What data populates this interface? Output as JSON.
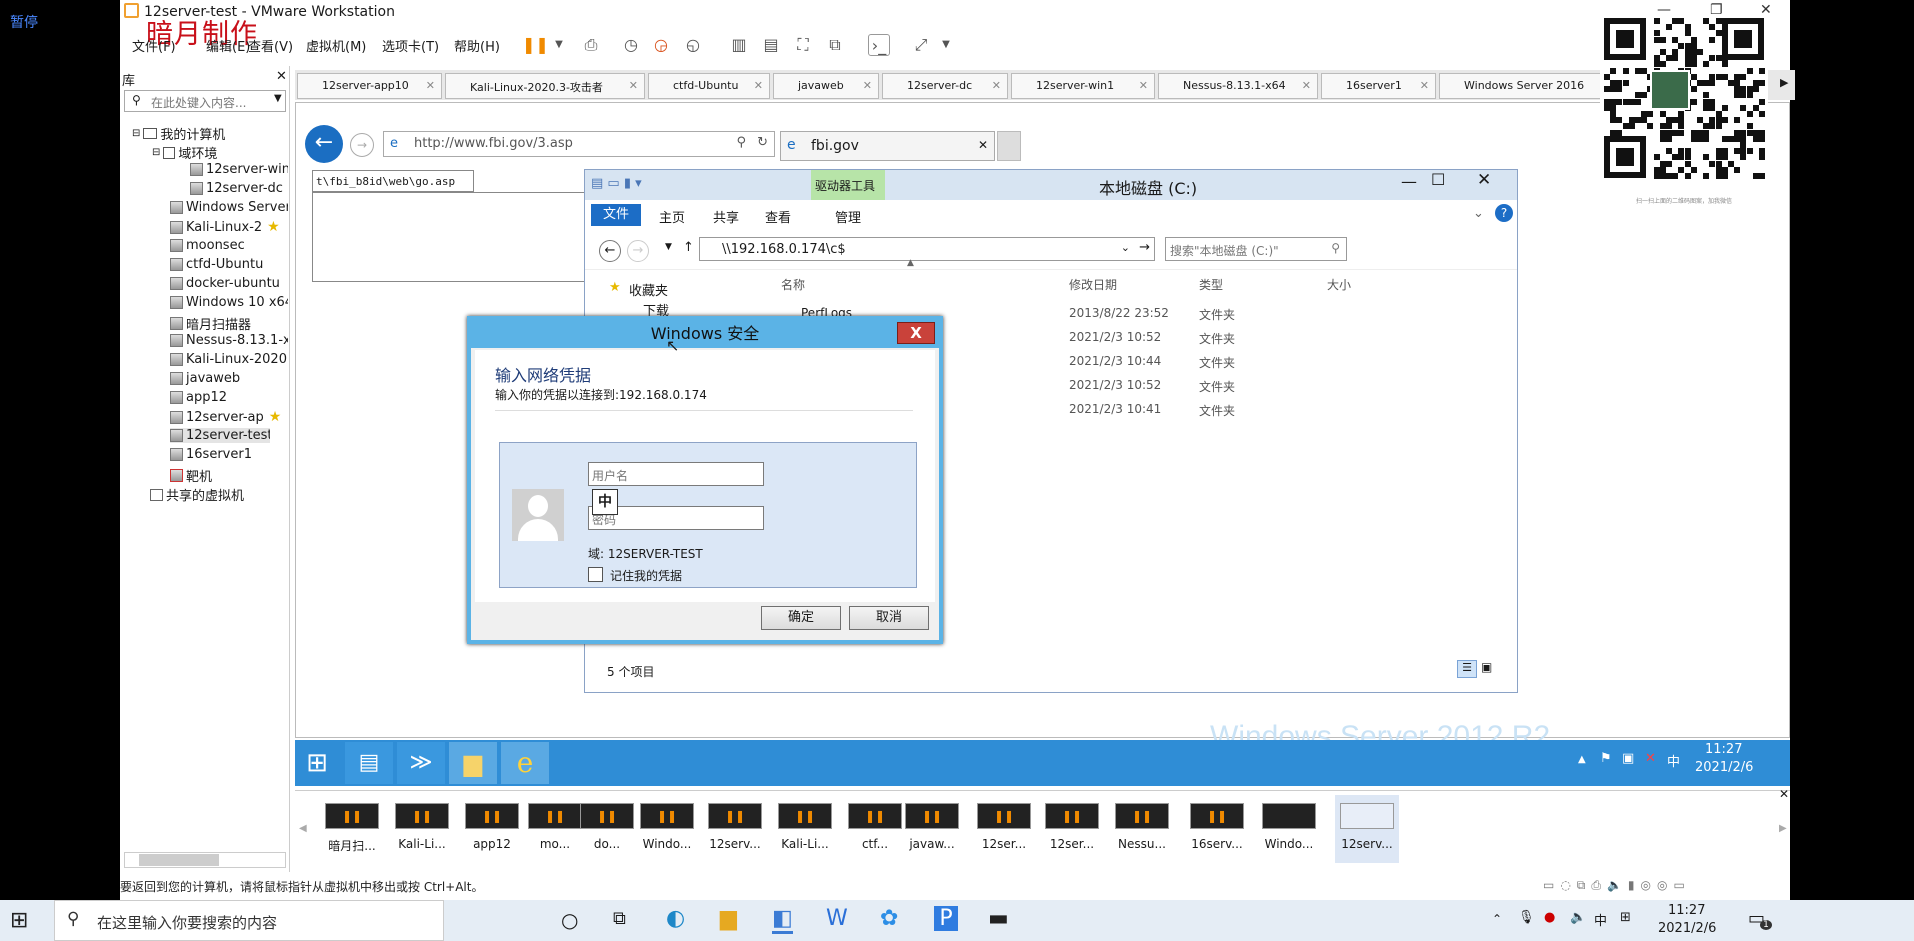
{
  "host": {
    "pause_label": "暂停"
  },
  "vmware": {
    "title": "12server-test - VMware Workstation",
    "watermark": "暗月制作",
    "menus": [
      "文件(F)",
      "编辑(E)",
      "查看(V)",
      "虚拟机(M)",
      "选项卡(T)",
      "帮助(H)"
    ],
    "library": {
      "header": "库",
      "search_placeholder": "在此处键入内容...",
      "tree": [
        "我的计算机",
        "域环境",
        "12server-win",
        "12server-dc",
        "Windows Server",
        "Kali-Linux-2",
        "moonsec",
        "ctfd-Ubuntu",
        "docker-ubuntu",
        "Windows 10 x64",
        "暗月扫描器",
        "Nessus-8.13.1-x",
        "Kali-Linux-2020.",
        "javaweb",
        "app12",
        "12server-ap",
        "12server-test",
        "16server1",
        "靶机",
        "共享的虚拟机"
      ]
    },
    "tabs": [
      "12server-app10",
      "Kali-Linux-2020.3-攻击者",
      "ctfd-Ubuntu",
      "javaweb",
      "12server-dc",
      "12server-win1",
      "Nessus-8.13.1-x64",
      "16server1",
      "Windows Server 2016"
    ],
    "thumbnails": [
      "暗月扫...",
      "Kali-Li...",
      "app12",
      "mo...",
      "do...",
      "Windo...",
      "12serv...",
      "Kali-Li...",
      "ctf...",
      "javaw...",
      "12ser...",
      "12ser...",
      "Nessu...",
      "16serv...",
      "Windo...",
      "12serv..."
    ],
    "status_text": "要返回到您的计算机，请将鼠标指针从虚拟机中移出或按 Ctrl+Alt。"
  },
  "ie": {
    "address": "http://www.fbi.gov/3.asp",
    "tab_title": "fbi.gov",
    "side_text": "t\\fbi_b8id\\web\\go.asp"
  },
  "explorer": {
    "title": "本地磁盘 (C:)",
    "drive_tools": "驱动器工具",
    "ribbon": [
      "文件",
      "主页",
      "共享",
      "查看",
      "管理"
    ],
    "path": "\\\\192.168.0.174\\c$",
    "search_placeholder": "搜索\"本地磁盘 (C:)\"",
    "nav": [
      "收藏夹",
      "下载"
    ],
    "columns": [
      "名称",
      "修改日期",
      "类型",
      "大小"
    ],
    "first_item": "PerfLogs",
    "rows": [
      {
        "date": "2013/8/22 23:52",
        "type": "文件夹"
      },
      {
        "date": "2021/2/3 10:52",
        "type": "文件夹"
      },
      {
        "date": "2021/2/3 10:44",
        "type": "文件夹"
      },
      {
        "date": "2021/2/3 10:52",
        "type": "文件夹"
      },
      {
        "date": "2021/2/3 10:41",
        "type": "文件夹"
      }
    ],
    "item_count": "5 个项目"
  },
  "dialog": {
    "title": "Windows 安全",
    "heading": "输入网络凭据",
    "subtitle": "输入你的凭据以连接到:192.168.0.174",
    "username_placeholder": "用户名",
    "password_placeholder": "密码",
    "ime_badge": "中",
    "domain": "域: 12SERVER-TEST",
    "remember": "记住我的凭据",
    "ok": "确定",
    "cancel": "取消"
  },
  "guest": {
    "time": "11:27",
    "date": "2021/2/6",
    "watermark": "Windows Server 2012 R2",
    "ime": "中"
  },
  "host_taskbar": {
    "search": "在这里输入你要搜索的内容",
    "time": "11:27",
    "date": "2021/2/6",
    "ime": "中",
    "notif": "1"
  },
  "qr": {
    "caption": "扫一扫上面的二维码图案，加我微信"
  }
}
